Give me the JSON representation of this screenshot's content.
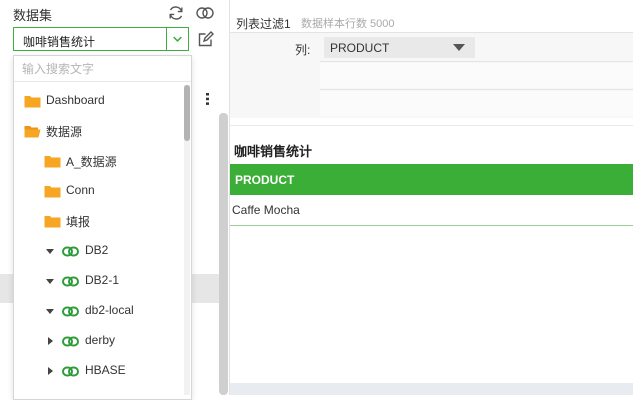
{
  "dataset_panel": {
    "title": "数据集",
    "selected": "咖啡销售统计",
    "icons": [
      "refresh-icon",
      "link-icon",
      "edit-icon",
      "chevron-down-icon"
    ]
  },
  "dropdown": {
    "search_placeholder": "输入搜索文字",
    "items": [
      {
        "label": "Dashboard",
        "type": "folder",
        "state": "closed"
      },
      {
        "label": "数据源",
        "type": "folder",
        "state": "open"
      },
      {
        "label": "A_数据源",
        "type": "folder",
        "state": "closed"
      },
      {
        "label": "Conn",
        "type": "folder",
        "state": "closed"
      },
      {
        "label": "填报",
        "type": "folder",
        "state": "closed"
      },
      {
        "label": "DB2",
        "type": "connection",
        "state": "expanded"
      },
      {
        "label": "DB2-1",
        "type": "connection",
        "state": "expanded"
      },
      {
        "label": "db2-local",
        "type": "connection",
        "state": "expanded"
      },
      {
        "label": "derby",
        "type": "connection",
        "state": "collapsed"
      },
      {
        "label": "HBASE",
        "type": "connection",
        "state": "collapsed"
      }
    ]
  },
  "filter": {
    "tab_title": "列表过滤1",
    "row_count": "数据样本行数 5000",
    "column_label": "列:",
    "column_value": "PRODUCT"
  },
  "table": {
    "title": "咖啡销售统计",
    "column": "PRODUCT",
    "rows": [
      "Caffe Mocha"
    ]
  },
  "colors": {
    "accent": "#3aae37",
    "folder": "#f6a623",
    "connection": "#2e9c3a"
  }
}
